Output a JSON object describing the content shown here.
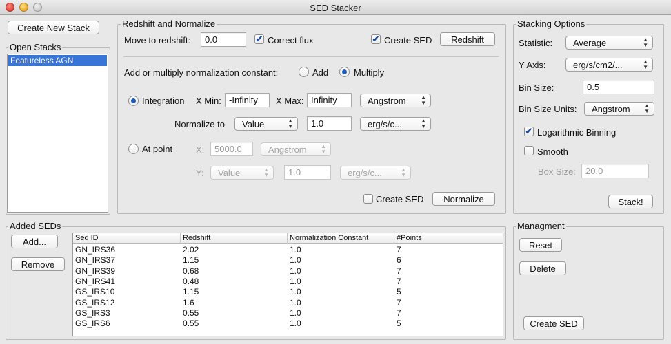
{
  "window": {
    "title": "SED Stacker"
  },
  "left": {
    "create_new_stack": "Create New Stack",
    "open_stacks_title": "Open Stacks",
    "stacks": [
      "Featureless AGN"
    ]
  },
  "redshift": {
    "title": "Redshift and Normalize",
    "move_label": "Move to redshift:",
    "move_value": "0.0",
    "correct_flux_label": "Correct flux",
    "correct_flux_checked": true,
    "create_sed_label": "Create SED",
    "create_sed_checked": true,
    "redshift_button": "Redshift",
    "norm_question": "Add or multiply normalization constant:",
    "add_label": "Add",
    "multiply_label": "Multiply",
    "selected_op": "Multiply",
    "integration_label": "Integration",
    "xmin_label": "X Min:",
    "xmin_value": "-Infinity",
    "xmax_label": "X Max:",
    "xmax_value": "Infinity",
    "x_units": "Angstrom",
    "normalize_to_label": "Normalize to",
    "normalize_to_value": "Value",
    "norm_value": "1.0",
    "y_units": "erg/s/c...",
    "at_point_label": "At point",
    "x_label": "X:",
    "x_point_value": "5000.0",
    "x_point_units": "Angstrom",
    "y_label": "Y:",
    "y_point_select": "Value",
    "y_point_value": "1.0",
    "y_point_units": "erg/s/c...",
    "create_sed_bottom_label": "Create SED",
    "create_sed_bottom_checked": false,
    "normalize_button": "Normalize"
  },
  "stacking": {
    "title": "Stacking Options",
    "statistic_label": "Statistic:",
    "statistic_value": "Average",
    "yaxis_label": "Y Axis:",
    "yaxis_value": "erg/s/cm2/...",
    "binsize_label": "Bin Size:",
    "binsize_value": "0.5",
    "binunits_label": "Bin Size Units:",
    "binunits_value": "Angstrom",
    "log_binning_label": "Logarithmic Binning",
    "log_binning_checked": true,
    "smooth_label": "Smooth",
    "smooth_checked": false,
    "boxsize_label": "Box Size:",
    "boxsize_value": "20.0",
    "stack_button": "Stack!"
  },
  "added": {
    "title": "Added SEDs",
    "add_button": "Add...",
    "remove_button": "Remove",
    "columns": [
      "Sed ID",
      "Redshift",
      "Normalization Constant",
      "#Points"
    ],
    "rows": [
      [
        "GN_IRS36",
        "2.02",
        "1.0",
        "7"
      ],
      [
        "GN_IRS37",
        "1.15",
        "1.0",
        "6"
      ],
      [
        "GN_IRS39",
        "0.68",
        "1.0",
        "7"
      ],
      [
        "GN_IRS41",
        "0.48",
        "1.0",
        "7"
      ],
      [
        "GS_IRS10",
        "1.15",
        "1.0",
        "5"
      ],
      [
        "GS_IRS12",
        "1.6",
        "1.0",
        "7"
      ],
      [
        "GS_IRS3",
        "0.55",
        "1.0",
        "7"
      ],
      [
        "GS_IRS6",
        "0.55",
        "1.0",
        "5"
      ]
    ]
  },
  "management": {
    "title": "Managment",
    "reset_button": "Reset",
    "delete_button": "Delete",
    "create_sed_button": "Create SED"
  }
}
